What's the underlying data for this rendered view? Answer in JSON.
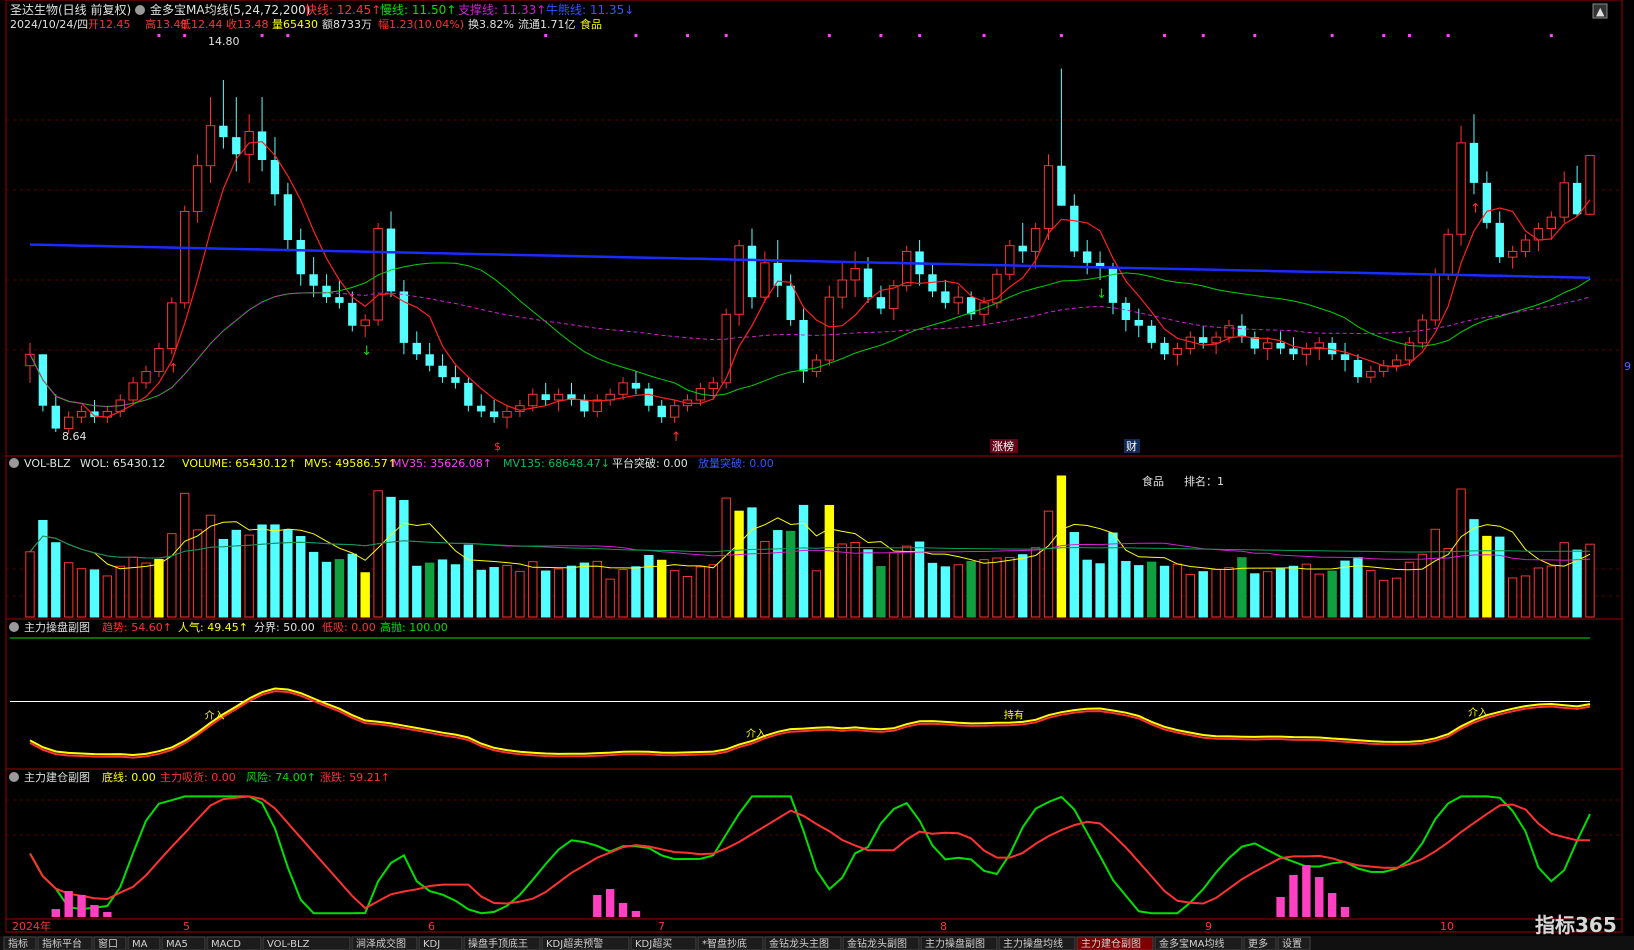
{
  "header": {
    "stock": "圣达生物(日线 前复权)",
    "indicator": "金多宝MA均线(5,24,72,200)",
    "fast_label": "快线: 12.45↑",
    "slow_label": "慢线: 11.50↑",
    "support_label": "支撑线: 11.33↑",
    "bull_label": "牛熊线: 11.35↓",
    "date": "2024/10/24/四",
    "open": "开12.45",
    "high": "高13.48",
    "low": "低12.44",
    "close": "收13.48",
    "volume": "量65430",
    "amount": "额8733万",
    "change": "幅1.23(10.04%)",
    "turnover": "换3.82%",
    "float": "流通1.71亿",
    "sector": "食品"
  },
  "price_panel": {
    "high_mark": "14.80",
    "low_mark": "8.64",
    "tags": [
      "$",
      "涨榜",
      "财"
    ],
    "right_tag": "9"
  },
  "vol_panel": {
    "title": "VOL-BLZ",
    "wol": "WOL: 65430.12",
    "volume": "VOLUME: 65430.12↑",
    "mv5": "MV5: 49586.57↑",
    "mv35": "MV35: 35626.08↑",
    "mv135": "MV135: 68648.47↓",
    "platform": "平台突破: 0.00",
    "break": "放量突破: 0.00",
    "rank_sector": "食品",
    "rank_label": "排名：1"
  },
  "ctrl_panel": {
    "title": "主力操盘副图",
    "trend": "趋势: 54.60↑",
    "pop": "人气: 49.45↑",
    "divide": "分界: 50.00",
    "low": "低吸: 0.00",
    "high": "高抛: 100.00",
    "marks": [
      "介入",
      "介入",
      "持有",
      "介入"
    ]
  },
  "build_panel": {
    "title": "主力建仓副图",
    "base": "底线: 0.00",
    "absorb": "主力吸货: 0.00",
    "risk": "风险: 74.00↑",
    "rise": "涨跌: 59.21↑"
  },
  "axis": {
    "months": [
      "2024年",
      "5",
      "6",
      "7",
      "8",
      "9",
      "10"
    ]
  },
  "bottom_tabs": [
    "指标",
    "指标平台",
    "窗口",
    "MA",
    "MA5",
    "MACD",
    "VOL-BLZ",
    "涧泽成交图",
    "KDJ",
    "操盘手顶底王",
    "KDJ超卖预警",
    "KDJ超买",
    "*智盘抄底",
    "金钻龙头主图",
    "金钻龙头副图",
    "主力操盘副图",
    "主力操盘均线",
    "主力建仓副图",
    "金多宝MA均线",
    "更多",
    "设置"
  ],
  "watermark": "指标365",
  "colors": {
    "up": "#ff3232",
    "down": "#54ffff",
    "ma_fast": "#ff2020",
    "ma_slow": "#00d000",
    "ma_support": "#d020d0",
    "ma_bull": "#1a2cff",
    "yellow": "#ffff00",
    "green": "#00e000",
    "pink": "#ff40c0",
    "white": "#ffffff"
  },
  "chart_data": {
    "type": "candlestick",
    "series": [
      {
        "name": "K线",
        "ohlc": [
          [
            9.8,
            10.2,
            9.5,
            10.0
          ],
          [
            10.0,
            10.0,
            9.0,
            9.1
          ],
          [
            9.1,
            9.3,
            8.64,
            8.7
          ],
          [
            8.7,
            9.0,
            8.6,
            8.9
          ],
          [
            8.9,
            9.1,
            8.8,
            9.0
          ],
          [
            9.0,
            9.2,
            8.8,
            8.9
          ],
          [
            8.9,
            9.1,
            8.8,
            9.0
          ],
          [
            9.0,
            9.3,
            8.9,
            9.2
          ],
          [
            9.2,
            9.6,
            9.1,
            9.5
          ],
          [
            9.5,
            9.8,
            9.4,
            9.7
          ],
          [
            9.7,
            10.2,
            9.6,
            10.1
          ],
          [
            10.1,
            11.0,
            10.0,
            10.9
          ],
          [
            10.9,
            12.6,
            10.8,
            12.5
          ],
          [
            12.5,
            13.5,
            12.3,
            13.3
          ],
          [
            13.3,
            14.5,
            13.0,
            14.0
          ],
          [
            14.0,
            14.8,
            13.6,
            13.8
          ],
          [
            13.8,
            14.5,
            13.2,
            13.5
          ],
          [
            13.5,
            14.2,
            13.0,
            13.9
          ],
          [
            13.9,
            14.5,
            13.2,
            13.4
          ],
          [
            13.4,
            13.8,
            12.6,
            12.8
          ],
          [
            12.8,
            13.0,
            11.8,
            12.0
          ],
          [
            12.0,
            12.2,
            11.2,
            11.4
          ],
          [
            11.4,
            11.7,
            11.0,
            11.2
          ],
          [
            11.2,
            11.4,
            10.9,
            11.0
          ],
          [
            11.0,
            11.3,
            10.8,
            10.9
          ],
          [
            10.9,
            11.1,
            10.4,
            10.5
          ],
          [
            10.5,
            10.7,
            10.3,
            10.6
          ],
          [
            10.6,
            12.3,
            10.5,
            12.2
          ],
          [
            12.2,
            12.5,
            11.0,
            11.1
          ],
          [
            11.1,
            11.3,
            10.0,
            10.2
          ],
          [
            10.2,
            10.4,
            9.9,
            10.0
          ],
          [
            10.0,
            10.2,
            9.7,
            9.8
          ],
          [
            9.8,
            10.0,
            9.5,
            9.6
          ],
          [
            9.6,
            9.8,
            9.4,
            9.5
          ],
          [
            9.5,
            9.6,
            9.0,
            9.1
          ],
          [
            9.1,
            9.3,
            8.9,
            9.0
          ],
          [
            9.0,
            9.2,
            8.8,
            8.9
          ],
          [
            8.9,
            9.1,
            8.7,
            9.0
          ],
          [
            9.0,
            9.2,
            8.9,
            9.1
          ],
          [
            9.1,
            9.4,
            9.0,
            9.3
          ],
          [
            9.3,
            9.5,
            9.1,
            9.2
          ],
          [
            9.2,
            9.4,
            9.0,
            9.3
          ],
          [
            9.3,
            9.5,
            9.1,
            9.2
          ],
          [
            9.2,
            9.3,
            8.9,
            9.0
          ],
          [
            9.0,
            9.3,
            8.9,
            9.2
          ],
          [
            9.2,
            9.4,
            9.1,
            9.3
          ],
          [
            9.3,
            9.6,
            9.2,
            9.5
          ],
          [
            9.5,
            9.7,
            9.3,
            9.4
          ],
          [
            9.4,
            9.5,
            9.0,
            9.1
          ],
          [
            9.1,
            9.2,
            8.8,
            8.9
          ],
          [
            8.9,
            9.2,
            8.8,
            9.1
          ],
          [
            9.1,
            9.3,
            9.0,
            9.2
          ],
          [
            9.2,
            9.5,
            9.1,
            9.4
          ],
          [
            9.4,
            9.6,
            9.2,
            9.5
          ],
          [
            9.5,
            10.8,
            9.4,
            10.7
          ],
          [
            10.7,
            12.0,
            10.5,
            11.9
          ],
          [
            11.9,
            12.2,
            10.8,
            11.0
          ],
          [
            11.0,
            11.8,
            10.9,
            11.6
          ],
          [
            11.6,
            12.0,
            11.0,
            11.2
          ],
          [
            11.2,
            11.4,
            10.5,
            10.6
          ],
          [
            10.6,
            10.8,
            9.5,
            9.7
          ],
          [
            9.7,
            10.0,
            9.6,
            9.9
          ],
          [
            9.9,
            11.2,
            9.8,
            11.0
          ],
          [
            11.0,
            11.6,
            10.8,
            11.3
          ],
          [
            11.3,
            11.8,
            11.0,
            11.5
          ],
          [
            11.5,
            11.7,
            10.9,
            11.0
          ],
          [
            11.0,
            11.2,
            10.7,
            10.8
          ],
          [
            10.8,
            11.3,
            10.6,
            11.2
          ],
          [
            11.2,
            11.9,
            11.1,
            11.8
          ],
          [
            11.8,
            12.0,
            11.2,
            11.4
          ],
          [
            11.4,
            11.6,
            11.0,
            11.1
          ],
          [
            11.1,
            11.3,
            10.8,
            10.9
          ],
          [
            10.9,
            11.2,
            10.7,
            11.0
          ],
          [
            11.0,
            11.1,
            10.6,
            10.7
          ],
          [
            10.7,
            11.0,
            10.5,
            10.9
          ],
          [
            10.9,
            11.5,
            10.8,
            11.4
          ],
          [
            11.4,
            12.0,
            11.3,
            11.9
          ],
          [
            11.9,
            12.3,
            11.6,
            11.8
          ],
          [
            11.8,
            12.3,
            11.5,
            12.2
          ],
          [
            12.2,
            13.5,
            12.0,
            13.3
          ],
          [
            13.3,
            15.0,
            12.8,
            12.6
          ],
          [
            12.6,
            12.8,
            11.7,
            11.8
          ],
          [
            11.8,
            12.0,
            11.4,
            11.6
          ],
          [
            11.6,
            11.8,
            11.3,
            11.5
          ],
          [
            11.5,
            11.6,
            10.7,
            10.9
          ],
          [
            10.9,
            11.0,
            10.4,
            10.6
          ],
          [
            10.6,
            10.8,
            10.3,
            10.5
          ],
          [
            10.5,
            10.6,
            10.1,
            10.2
          ],
          [
            10.2,
            10.3,
            9.9,
            10.0
          ],
          [
            10.0,
            10.2,
            9.8,
            10.1
          ],
          [
            10.1,
            10.4,
            10.0,
            10.3
          ],
          [
            10.3,
            10.5,
            10.1,
            10.2
          ],
          [
            10.2,
            10.4,
            10.0,
            10.3
          ],
          [
            10.3,
            10.6,
            10.2,
            10.5
          ],
          [
            10.5,
            10.7,
            10.2,
            10.3
          ],
          [
            10.3,
            10.4,
            10.0,
            10.1
          ],
          [
            10.1,
            10.3,
            9.9,
            10.2
          ],
          [
            10.2,
            10.4,
            10.0,
            10.1
          ],
          [
            10.1,
            10.3,
            9.9,
            10.0
          ],
          [
            10.0,
            10.2,
            9.8,
            10.1
          ],
          [
            10.1,
            10.3,
            9.9,
            10.2
          ],
          [
            10.2,
            10.3,
            9.9,
            10.0
          ],
          [
            10.0,
            10.2,
            9.7,
            9.9
          ],
          [
            9.9,
            10.0,
            9.5,
            9.6
          ],
          [
            9.6,
            9.8,
            9.5,
            9.7
          ],
          [
            9.7,
            9.9,
            9.6,
            9.8
          ],
          [
            9.8,
            10.0,
            9.7,
            9.9
          ],
          [
            9.9,
            10.3,
            9.8,
            10.2
          ],
          [
            10.2,
            10.7,
            10.1,
            10.6
          ],
          [
            10.6,
            11.5,
            10.5,
            11.4
          ],
          [
            11.4,
            12.2,
            11.3,
            12.1
          ],
          [
            12.1,
            14.0,
            11.9,
            13.7
          ],
          [
            13.7,
            14.2,
            12.8,
            13.0
          ],
          [
            13.0,
            13.2,
            12.2,
            12.3
          ],
          [
            12.3,
            12.5,
            11.6,
            11.7
          ],
          [
            11.7,
            11.9,
            11.5,
            11.8
          ],
          [
            11.8,
            12.1,
            11.7,
            12.0
          ],
          [
            12.0,
            12.3,
            11.8,
            12.2
          ],
          [
            12.2,
            12.5,
            12.0,
            12.4
          ],
          [
            12.4,
            13.2,
            12.3,
            13.0
          ],
          [
            13.0,
            13.3,
            12.4,
            12.45
          ],
          [
            12.45,
            13.48,
            12.44,
            13.48
          ]
        ]
      }
    ],
    "ylim": [
      8.5,
      15.5
    ],
    "legend": "top-left"
  }
}
